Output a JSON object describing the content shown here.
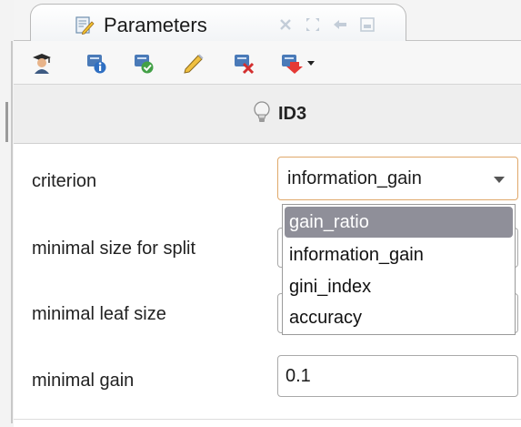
{
  "tab": {
    "title": "Parameters",
    "icon": "edit-parameters-icon",
    "controls": [
      "close-icon",
      "maximize-icon",
      "restore-icon",
      "minimize-icon"
    ]
  },
  "toolbar": {
    "buttons": [
      "expert-mode-icon",
      "operator-info-icon",
      "enable-operator-icon",
      "edit-icon",
      "remove-icon",
      "breakpoint-dropdown-icon"
    ]
  },
  "operator": {
    "icon": "lightbulb-icon",
    "name": "ID3"
  },
  "parameters": [
    {
      "label": "criterion",
      "value": "information_gain"
    },
    {
      "label": "minimal size for split",
      "value": ""
    },
    {
      "label": "minimal leaf size",
      "value": ""
    },
    {
      "label": "minimal gain",
      "value": "0.1"
    }
  ],
  "dropdown": {
    "options": [
      "gain_ratio",
      "information_gain",
      "gini_index",
      "accuracy"
    ],
    "highlighted": "gain_ratio"
  },
  "colors": {
    "highlight": "#8f8f99",
    "focus_border": "#e0a86a"
  }
}
